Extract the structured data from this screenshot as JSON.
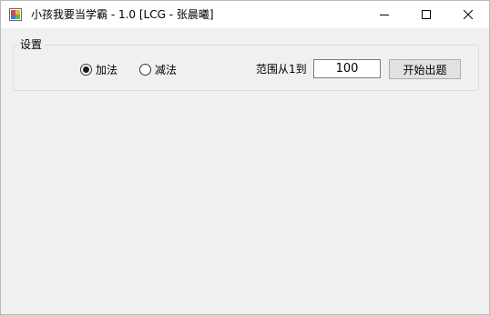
{
  "window": {
    "title": "小孩我要当学霸 - 1.0 [LCG - 张晨曦]",
    "controls": [
      "minimize-icon",
      "maximize-icon",
      "close-icon"
    ]
  },
  "settings": {
    "group_label": "设置",
    "operations": [
      {
        "label": "加法",
        "selected": true
      },
      {
        "label": "减法",
        "selected": false
      }
    ],
    "range_label": "范围从1到",
    "range_value": "100",
    "start_button": "开始出题"
  }
}
